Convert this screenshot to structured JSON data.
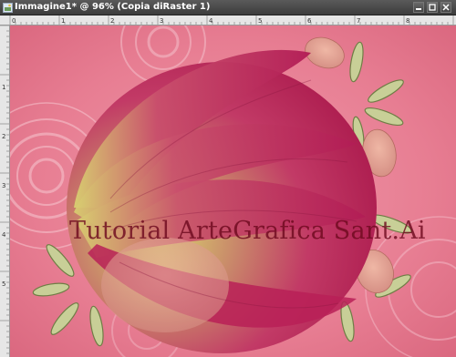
{
  "window": {
    "title": "Immagine1* @ 96% (Copia diRaster 1)",
    "zoom": "96%"
  },
  "canvas": {
    "watermark": "Tutorial ArteGrafica Sant.Ai",
    "colors": {
      "background": "#e77d92",
      "petal": "#c2285a",
      "petal_base": "#d9d86e",
      "leaf": "#b8c08a"
    }
  },
  "rulers": {
    "top_marks": [
      "0",
      "1",
      "2",
      "3",
      "4",
      "5",
      "6",
      "7",
      "8"
    ],
    "left_marks": [
      "1",
      "2",
      "3",
      "4",
      "5"
    ]
  }
}
